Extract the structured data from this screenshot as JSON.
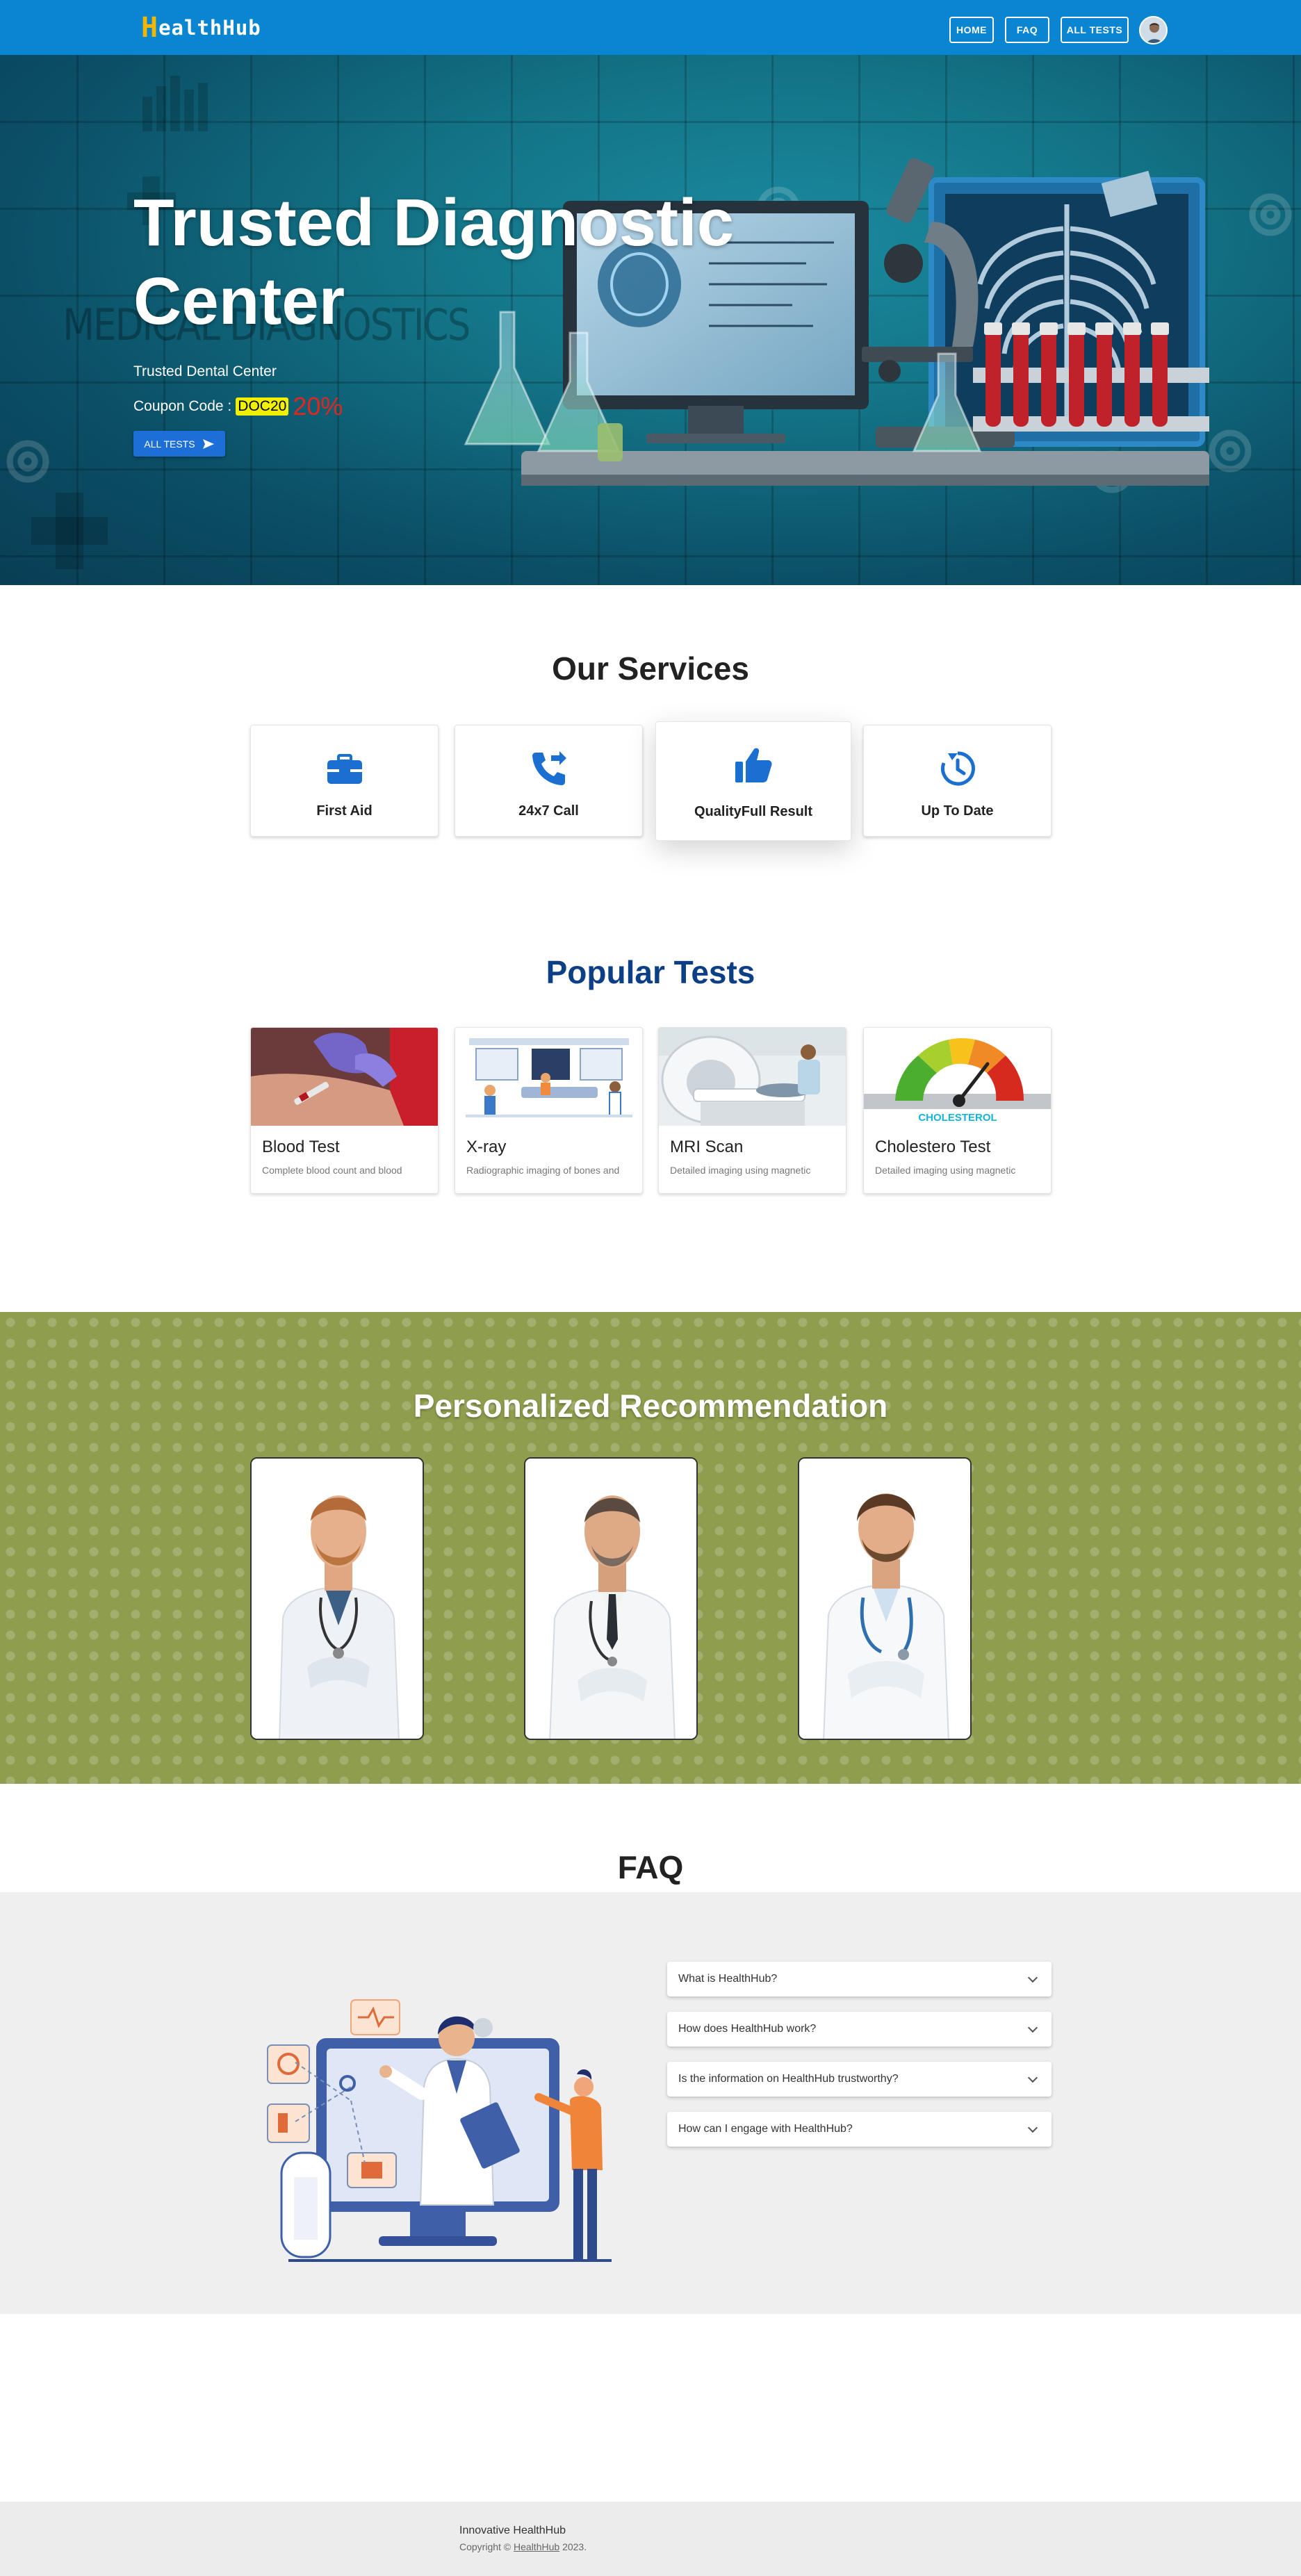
{
  "navbar": {
    "brand_initial": "H",
    "brand_rest": "ealthHub",
    "links": {
      "home": "HOME",
      "faq": "FAQ",
      "all_tests": "ALL TESTS"
    },
    "avatar_icon": "user-avatar"
  },
  "hero": {
    "title": "Trusted Diagnostic Center",
    "subtitle": "Trusted Dental Center",
    "coupon_label": "Coupon Code :",
    "coupon_code": "DOC20",
    "coupon_discount": "20%",
    "button_label": "ALL TESTS",
    "button_icon": "send-icon"
  },
  "services": {
    "title": "Our Services",
    "items": [
      {
        "label": "First Aid",
        "icon": "briefcase-medical-icon"
      },
      {
        "label": "24x7 Call",
        "icon": "phone-forward-icon"
      },
      {
        "label": "QualityFull Result",
        "icon": "thumbs-up-icon"
      },
      {
        "label": "Up To Date",
        "icon": "history-icon"
      }
    ]
  },
  "popular_tests": {
    "title": "Popular Tests",
    "items": [
      {
        "name": "Blood Test",
        "desc": "Complete blood count and blood"
      },
      {
        "name": "X-ray",
        "desc": "Radiographic imaging of bones and"
      },
      {
        "name": "MRI Scan",
        "desc": "Detailed imaging using magnetic"
      },
      {
        "name": "Cholestero Test",
        "desc": "Detailed imaging using magnetic"
      }
    ],
    "cholesterol_image_text": "CHOLESTEROL"
  },
  "recommendation": {
    "title": "Personalized Recommendation"
  },
  "faq": {
    "title": "FAQ",
    "items": [
      "What is HealthHub?",
      "How does HealthHub work?",
      "Is the information on HealthHub trustworthy?",
      "How can I engage with HealthHub?"
    ]
  },
  "footer": {
    "name": "Innovative HealthHub",
    "copy_prefix": "Copyright ©",
    "copy_link": "HealthHub",
    "copy_suffix": "2023."
  },
  "colors": {
    "navbar": "#0a85d1",
    "brand_accent": "#f2b705",
    "primary_button": "#1c6fd6",
    "tests_title": "#0d3f86",
    "recommendation_bg": "#8f9d4e",
    "coupon_highlight": "#f0f000",
    "discount_red": "#e0261e",
    "icon_blue": "#1a6fd1"
  }
}
